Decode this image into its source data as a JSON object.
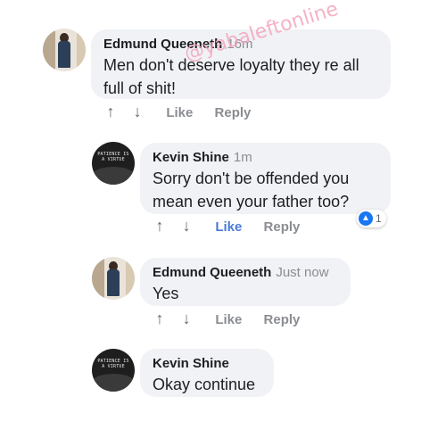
{
  "watermark": "@yabaleftonline",
  "comments": [
    {
      "author": "Edmund Queeneth",
      "time": "16m",
      "text_lines": [
        "Men don't deserve loyalty they re all",
        "full of shit!"
      ],
      "actions": {
        "up": "↑",
        "down": "↓",
        "like": "Like",
        "reply": "Reply"
      }
    },
    {
      "author": "Kevin Shine",
      "time": "1m",
      "text_lines": [
        "Sorry don't be offended you",
        "mean even your father too?"
      ],
      "actions": {
        "up": "↑",
        "down": "↓",
        "like": "Like",
        "reply": "Reply"
      },
      "reaction": {
        "icon": "like-reaction-icon",
        "count": "1"
      }
    },
    {
      "author": "Edmund Queeneth",
      "time": "Just now",
      "text_lines": [
        "Yes"
      ],
      "actions": {
        "up": "↑",
        "down": "↓",
        "like": "Like",
        "reply": "Reply"
      }
    },
    {
      "author": "Kevin Shine",
      "time": "",
      "text_lines": [
        "Okay continue"
      ]
    }
  ],
  "avatar_text": "PATIENCE IS A VIRTUE",
  "colors": {
    "bubble": "#f0f2f5",
    "liked": "#4b7bd6",
    "muted": "#8a8d91"
  }
}
